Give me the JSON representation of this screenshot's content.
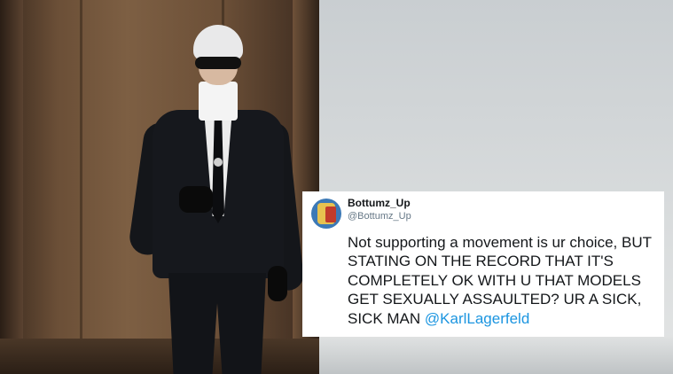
{
  "tweet": {
    "display_name": "Bottumz_Up",
    "handle": "@Bottumz_Up",
    "text": "Not supporting a movement is ur choice, BUT STATING ON THE RECORD THAT IT'S COMPLETELY OK WITH U THAT MODELS GET SEXUALLY ASSAULTED? UR A SICK, SICK MAN ",
    "mention": "@KarlLagerfeld",
    "mention_color": "#1b95e0"
  }
}
